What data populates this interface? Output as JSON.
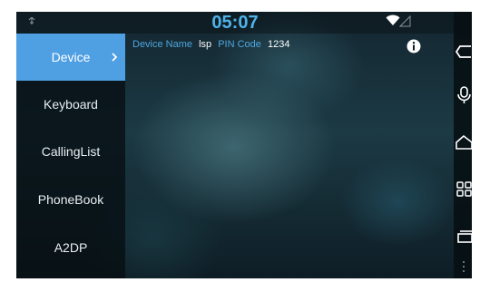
{
  "status": {
    "time": "05:07",
    "icons": [
      "usb-icon",
      "wifi-icon",
      "signal-icon"
    ]
  },
  "sidebar": {
    "items": [
      {
        "label": "Device",
        "active": true
      },
      {
        "label": "Keyboard",
        "active": false
      },
      {
        "label": "CallingList",
        "active": false
      },
      {
        "label": "PhoneBook",
        "active": false
      },
      {
        "label": "A2DP",
        "active": false
      }
    ]
  },
  "device": {
    "name_label": "Device Name",
    "name_value": "lsp",
    "pin_label": "PIN Code",
    "pin_value": "1234"
  },
  "nav": {
    "icons": [
      "back-icon",
      "microphone-icon",
      "home-icon",
      "apps-icon",
      "recent-icon",
      "more-icon"
    ]
  },
  "colors": {
    "accent": "#4f9fe3",
    "clock": "#4fb3ea",
    "label": "#4fa6e0"
  }
}
